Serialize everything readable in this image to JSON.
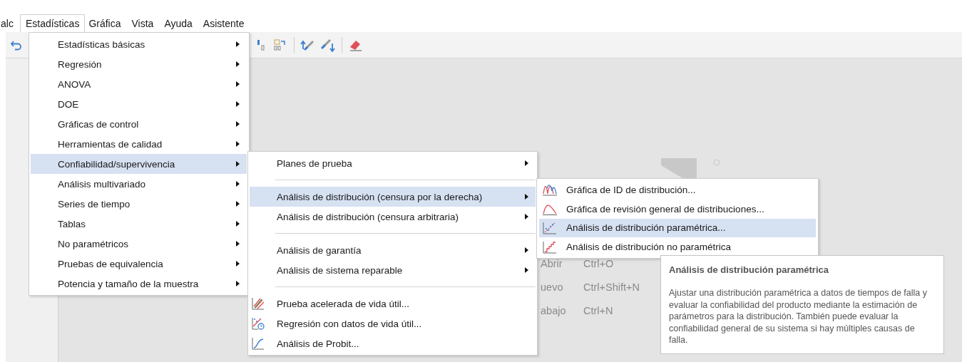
{
  "menu_bar": [
    {
      "label": "alc",
      "selected": false
    },
    {
      "label": "Estadísticas",
      "selected": true
    },
    {
      "label": "Gráfica",
      "selected": false
    },
    {
      "label": "Vista",
      "selected": false
    },
    {
      "label": "Ayuda",
      "selected": false
    },
    {
      "label": "Asistente",
      "selected": false
    }
  ],
  "stats_menu": {
    "items": [
      {
        "label": "Estadísticas básicas",
        "submenu": true,
        "selected": false
      },
      {
        "label": "Regresión",
        "submenu": true,
        "selected": false
      },
      {
        "label": "ANOVA",
        "submenu": true,
        "selected": false
      },
      {
        "label": "DOE",
        "submenu": true,
        "selected": false
      },
      {
        "label": "Gráficas de control",
        "submenu": true,
        "selected": false
      },
      {
        "label": "Herramientas de calidad",
        "submenu": true,
        "selected": false
      },
      {
        "label": "Confiabilidad/supervivencia",
        "submenu": true,
        "selected": true
      },
      {
        "label": "Análisis multivariado",
        "submenu": true,
        "selected": false
      },
      {
        "label": "Series de tiempo",
        "submenu": true,
        "selected": false
      },
      {
        "label": "Tablas",
        "submenu": true,
        "selected": false
      },
      {
        "label": "No paramétricos",
        "submenu": true,
        "selected": false
      },
      {
        "label": "Pruebas de equivalencia",
        "submenu": true,
        "selected": false
      },
      {
        "label": "Potencia y tamaño de la muestra",
        "submenu": true,
        "selected": false
      }
    ]
  },
  "reliability_menu": {
    "items": [
      {
        "kind": "submenu",
        "label": "Planes de prueba",
        "selected": false
      },
      {
        "kind": "separator"
      },
      {
        "kind": "submenu",
        "label": "Análisis de distribución (censura por la derecha)",
        "selected": true
      },
      {
        "kind": "submenu",
        "label": "Análisis de distribución (censura arbitraria)",
        "selected": false
      },
      {
        "kind": "separator"
      },
      {
        "kind": "submenu",
        "label": "Análisis de garantía",
        "selected": false
      },
      {
        "kind": "submenu",
        "label": "Análisis de sistema reparable",
        "selected": false
      },
      {
        "kind": "separator"
      },
      {
        "kind": "command",
        "label": "Prueba acelerada de vida útil...",
        "selected": false
      },
      {
        "kind": "command",
        "label": "Regresión con datos de vida útil...",
        "selected": false
      },
      {
        "kind": "command",
        "label": "Análisis de Probit...",
        "selected": false
      }
    ]
  },
  "distribution_menu": {
    "items": [
      {
        "label": "Gráfica de ID de distribución...",
        "selected": false
      },
      {
        "label": "Gráfica de revisión general de distribuciones...",
        "selected": false
      },
      {
        "label": "Análisis de distribución paramétrica...",
        "selected": true
      },
      {
        "label": "Análisis de distribución no paramétrica",
        "selected": false
      }
    ]
  },
  "tooltip": {
    "title": "Análisis de distribución paramétrica",
    "body": "Ajustar una distribución paramétrica a datos de tiempos de falla y evaluar la confiabilidad del producto mediante la estimación de parámetros para la distribución. También puede evaluar la confiabilidad general de su sistema si hay múltiples causas de falla."
  },
  "start_page": {
    "shortcuts": [
      {
        "label": "Abrir",
        "keys": "Ctrl+O"
      },
      {
        "label": "uevo",
        "keys": "Ctrl+Shift+N"
      },
      {
        "label": "abajo",
        "keys": "Ctrl+N"
      }
    ]
  }
}
